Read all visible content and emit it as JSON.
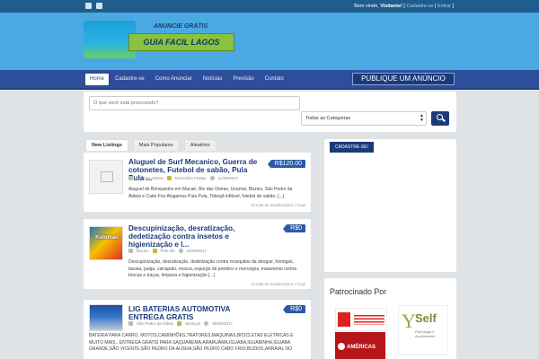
{
  "topbar": {
    "welcome_prefix": "Bem vindo,",
    "visitor": "Visitante!",
    "sep1": "[",
    "register": "Cadastre-se",
    "sep2": "|",
    "login": "Entrar",
    "sep3": "]"
  },
  "logo": {
    "tagline": "ANUNCIE GRÁTIS",
    "name": "GUIA FACIL LAGOS"
  },
  "nav": {
    "items": [
      "Home",
      "Cadastre-se",
      "Como Anunciar",
      "Notícias",
      "Previsão",
      "Contato"
    ],
    "active": "Home",
    "cta": "PUBLIQUE UM ANÚNCIO"
  },
  "search": {
    "placeholder": "O que você está procurando?",
    "category": "Todas as Categorias"
  },
  "tabs": [
    "New Listings",
    "Mais Populares",
    "Aleatório"
  ],
  "listings": [
    {
      "title": "Aluguel de Surf Mecanico, Guerra de cotonetes, Futebol de sabão, Pula Pula ...",
      "price": "R$120.00",
      "location": "Rio das Ostras",
      "category": "Diversões Festas",
      "date": "21/09/2017",
      "desc": "Aluguel de Brinquedos em Macaé, Rio das Ostras, Unamar, Búzios, São Pedro da Aldeia e Cabo Frio Alugamos Pula Pula, Tobogã inflável, futebol de sabão, [...]",
      "views": "34 total de visualizações, 0 hoje"
    },
    {
      "title": "Descupinização, desratização, dedetização contra insetos e higienização e l...",
      "price": "R$0",
      "thumb_text": "Koloman",
      "location": "Búzios",
      "category": "Pets life",
      "date": "20/09/2017",
      "desc": "Descupinização, desratização, dedetização contra mosquitos da dengue, formigas, barata, pulga, carrapato, mosca, expurgo de pombos e morcegos, tratamento contra brocas e traças, limpeza e higienização [...]",
      "views": "14 total de visualizações, 0 hoje"
    },
    {
      "title": "LIG BATERIAS AUTOMOTIVA ENTREGA GRATIS",
      "price": "R$0",
      "location": "São Pedro da Aldeia",
      "category": "Serviços",
      "date": "08/09/2017",
      "desc": "BATERIA PARA CARRO, MOTOS,CAMINHÕES,TRATORES,MAQUINAS,BICICLETAS ELÉTRICAS E MUITO MAIS.. ENTREGA GRATIS PARA SAQUAREMA,ARARUAMA,IGUABA,IGUABINHA,IGUABA GRANDE,SÃO VICENTE,SÃO PEDRO DA ALDEIA,SÃO PEDRO CABO FRIO,BÚZIOS,ARRAIAL DO"
    }
  ],
  "sidebar": {
    "register_button": "CADASTRE-SE!",
    "sponsor_title": "Patrocinado Por",
    "americas_text": "AMÉRICAS",
    "self_text": "Self",
    "self_sub": "Psicologia e Acolhimento"
  },
  "colors": {
    "navy": "#1b3a7a",
    "sky": "#4aa9e2",
    "nav_blue": "#2d4e9a",
    "price_blue": "#2d5aa8"
  }
}
